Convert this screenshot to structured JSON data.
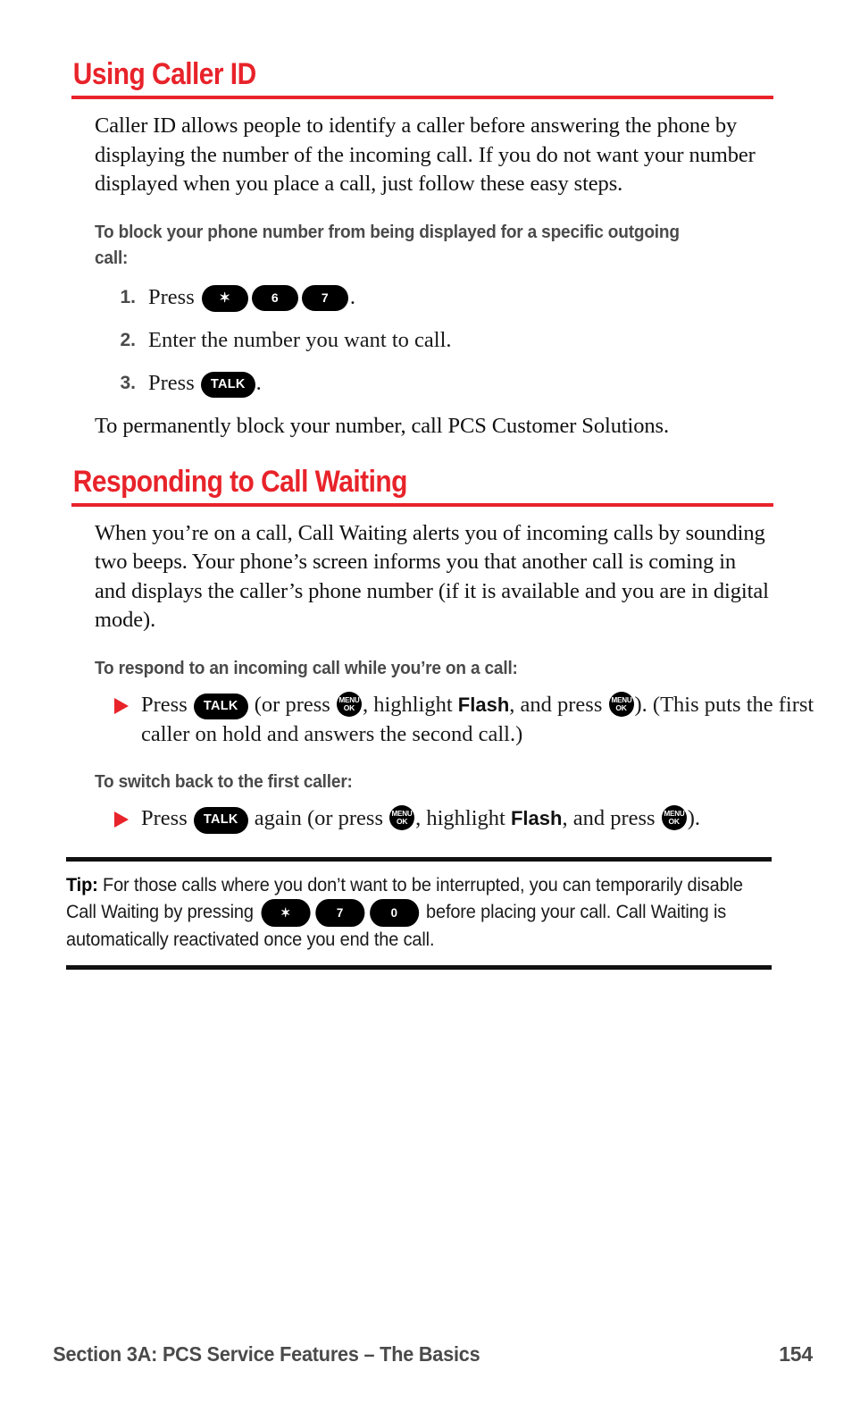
{
  "page": {
    "accent_red": "#e8232a",
    "subhead_gray": "#4a4a4a",
    "body_black": "#111111"
  },
  "sections": [
    {
      "heading": "Using Caller ID",
      "intro": "Caller ID allows people to identify a caller before answering the phone by displaying the number of the incoming call. If you do not want your number displayed when you place a call, just follow these easy steps.",
      "subhead": "To block your phone number from being displayed for a specific outgoing call:",
      "steps": [
        {
          "num": "1.",
          "pre": "Press",
          "keys": [
            "✶",
            "6",
            "7"
          ],
          "post": "."
        },
        {
          "num": "2.",
          "text": "Enter the number you want to call."
        },
        {
          "num": "3.",
          "pre": "Press",
          "key_talk": "TALK",
          "post": "."
        }
      ],
      "closing": "To permanently block your number, call PCS Customer Solutions."
    },
    {
      "heading": "Responding to Call Waiting",
      "intro": "When you’re on a call, Call Waiting alerts you of incoming calls by sounding two beeps. Your phone’s screen informs you that another call is coming in and displays the caller’s phone number (if it is available and you are in digital mode).",
      "subhead_1": "To respond to an incoming call while you’re on a call:",
      "bullet_1": {
        "p1": "Press",
        "key_talk": "TALK",
        "p2": "(or press",
        "menu_line1": "MENU",
        "menu_line2": "OK",
        "p3": ", highlight",
        "flash": "Flash",
        "p4": ", and press",
        "p5": "). (This puts the first caller on hold and answers the second call.)"
      },
      "subhead_2": "To switch back to the first caller:",
      "bullet_2": {
        "p1": "Press",
        "key_talk": "TALK",
        "p2": "again (or press",
        "menu_line1": "MENU",
        "menu_line2": "OK",
        "p3": ", highlight",
        "flash": "Flash",
        "p4": ", and press",
        "p5": ")."
      }
    }
  ],
  "tip": {
    "label": "Tip:",
    "part1": "For those calls where you don’t want to be interrupted, you can temporarily disable Call Waiting by pressing",
    "keys": [
      "✶",
      "7",
      "0"
    ],
    "part2": "before placing your call. Call Waiting is automatically reactivated once you end the call."
  },
  "footer": {
    "left": "Section 3A: PCS Service Features – The Basics",
    "page_number": "154"
  }
}
